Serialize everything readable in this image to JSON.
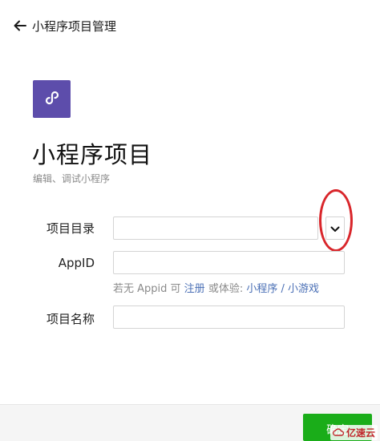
{
  "header": {
    "back_icon": "arrow-left-icon",
    "title": "小程序项目管理"
  },
  "logo": {
    "icon": "mini-program-icon",
    "color": "#5d4dab"
  },
  "main": {
    "heading": "小程序项目",
    "subheading": "编辑、调试小程序"
  },
  "form": {
    "directory": {
      "label": "项目目录",
      "value": "",
      "dropdown_icon": "chevron-down-icon"
    },
    "appid": {
      "label": "AppID",
      "value": "",
      "hint_prefix": "若无 Appid 可",
      "hint_register": "注册",
      "hint_middle": "或体验:",
      "hint_mini_program": "小程序",
      "hint_sep": "/",
      "hint_mini_game": "小游戏"
    },
    "name": {
      "label": "项目名称",
      "value": ""
    }
  },
  "footer": {
    "confirm_label": "确定"
  },
  "watermark": {
    "text": "亿速云"
  },
  "colors": {
    "accent_green": "#1aad19",
    "link_blue": "#4a6fb5",
    "highlight_red": "#d9262b"
  }
}
